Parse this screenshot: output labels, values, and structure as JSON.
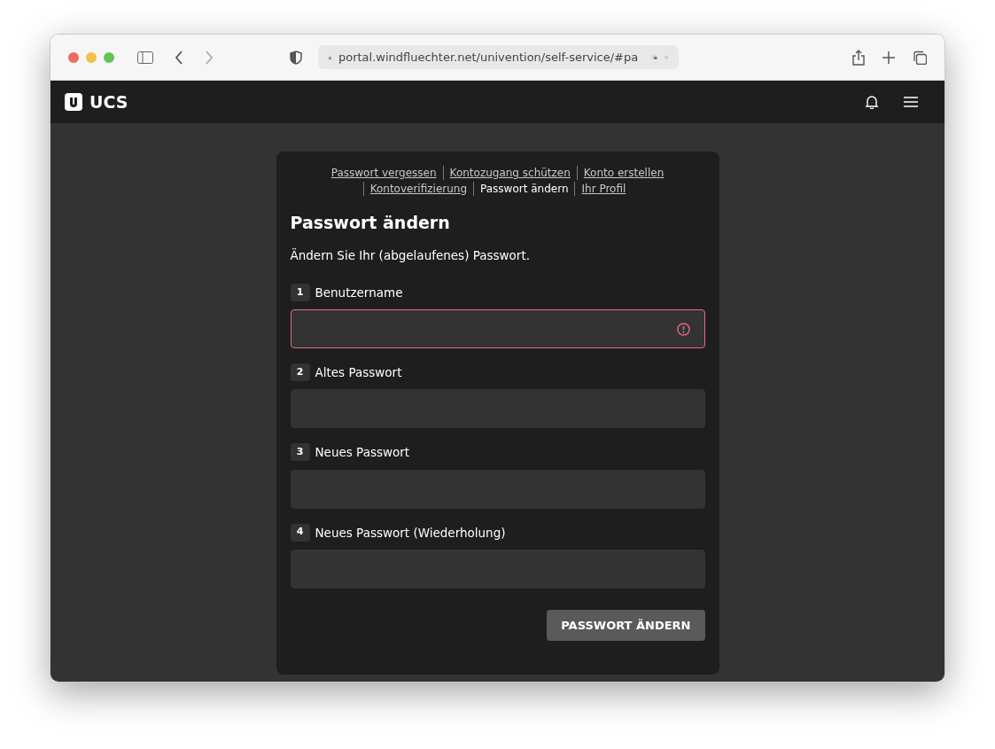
{
  "browser": {
    "url": "portal.windfluechter.net/univention/self-service/#pa"
  },
  "header": {
    "logo_text": "UCS"
  },
  "nav": [
    {
      "label": "Passwort vergessen",
      "selected": false
    },
    {
      "label": "Kontozugang schützen",
      "selected": false
    },
    {
      "label": "Konto erstellen",
      "selected": false
    },
    {
      "label": "Kontoverifizierung",
      "selected": false
    },
    {
      "label": "Passwort ändern",
      "selected": true
    },
    {
      "label": "Ihr Profil",
      "selected": false
    }
  ],
  "title": "Passwort ändern",
  "description": "Ändern Sie Ihr (abgelaufenes) Passwort.",
  "fields": [
    {
      "number": "1",
      "label": "Benutzername",
      "error": true
    },
    {
      "number": "2",
      "label": "Altes Passwort",
      "error": false
    },
    {
      "number": "3",
      "label": "Neues Passwort",
      "error": false
    },
    {
      "number": "4",
      "label": "Neues Passwort (Wiederholung)",
      "error": false
    }
  ],
  "submit": "PASSWORT ÄNDERN"
}
